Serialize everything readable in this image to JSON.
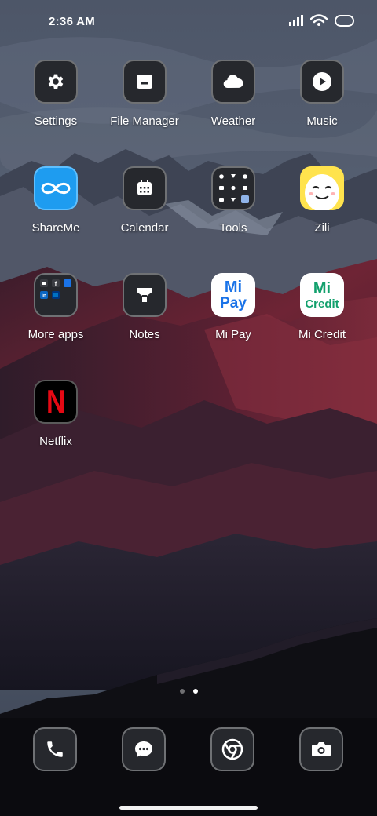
{
  "status_bar": {
    "time": "2:36 AM",
    "icons": [
      "signal-icon",
      "wifi-icon",
      "battery-icon"
    ]
  },
  "apps": [
    {
      "label": "Settings",
      "icon": "gear-icon"
    },
    {
      "label": "File Manager",
      "icon": "folder-icon"
    },
    {
      "label": "Weather",
      "icon": "cloud-icon"
    },
    {
      "label": "Music",
      "icon": "play-icon"
    },
    {
      "label": "ShareMe",
      "icon": "infinity-icon"
    },
    {
      "label": "Calendar",
      "icon": "calendar-icon"
    },
    {
      "label": "Tools",
      "icon": "tools-folder-icon"
    },
    {
      "label": "Zili",
      "icon": "smiley-face-icon"
    },
    {
      "label": "More apps",
      "icon": "apps-folder-icon"
    },
    {
      "label": "Notes",
      "icon": "funnel-note-icon"
    },
    {
      "label": "Mi Pay",
      "icon": "mi-pay-logo",
      "logo_line1": "Mi",
      "logo_line2": "Pay"
    },
    {
      "label": "Mi Credit",
      "icon": "mi-credit-logo",
      "logo_line1": "Mi",
      "logo_line2": "Credit"
    },
    {
      "label": "Netflix",
      "icon": "netflix-logo",
      "logo_letter": "N"
    }
  ],
  "page_indicator": {
    "pages": 2,
    "active_page": 2
  },
  "dock": [
    {
      "icon": "phone-icon"
    },
    {
      "icon": "messaging-icon"
    },
    {
      "icon": "chrome-icon"
    },
    {
      "icon": "camera-icon"
    }
  ],
  "colors": {
    "shareme_blue": "#1e9cf0",
    "zili_yellow": "#ffe34d",
    "mi_blue": "#1a73e8",
    "mi_green": "#12a06c",
    "netflix_red": "#e50914",
    "dark_icon_bg": "#26282d"
  }
}
